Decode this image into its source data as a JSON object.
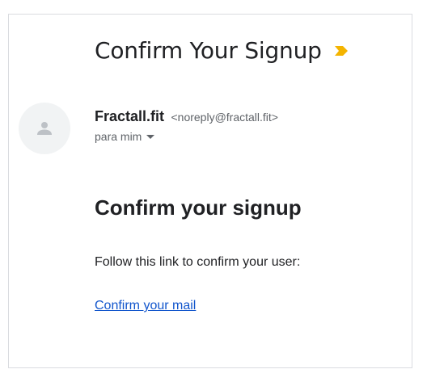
{
  "email": {
    "subject": "Confirm Your Signup",
    "important_marker_icon": "important-marker-icon",
    "important_marker_color": "#f4b400",
    "sender": {
      "name": "Fractall.fit",
      "email": "<noreply@fractall.fit>",
      "avatar_icon": "person-icon"
    },
    "recipient_label": "para mim",
    "body": {
      "heading": "Confirm your signup",
      "text": "Follow this link to confirm your user:",
      "link_label": "Confirm your mail"
    }
  }
}
